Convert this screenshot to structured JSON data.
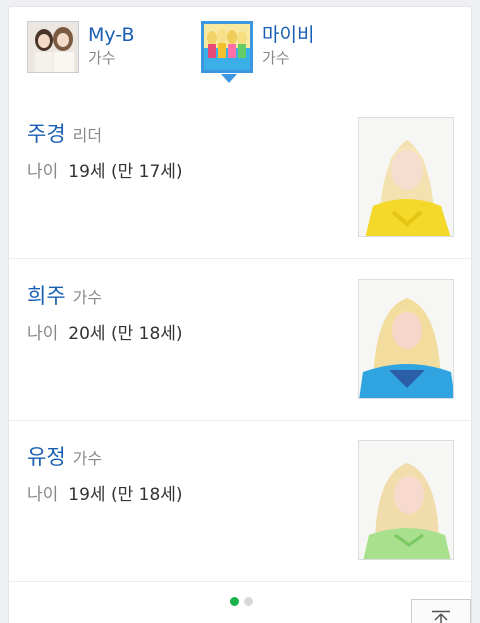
{
  "groups": [
    {
      "name": "My-B",
      "sub": "가수",
      "thumb_icon": "group-photo-icon",
      "active": false
    },
    {
      "name": "마이비",
      "sub": "가수",
      "thumb_icon": "group-photo-icon",
      "active": true
    }
  ],
  "members": [
    {
      "name": "주경",
      "role": "리더",
      "age_label": "나이",
      "age": "19세 (만 17세)",
      "photo_icon": "member-photo-icon"
    },
    {
      "name": "희주",
      "role": "가수",
      "age_label": "나이",
      "age": "20세 (만 18세)",
      "photo_icon": "member-photo-icon"
    },
    {
      "name": "유정",
      "role": "가수",
      "age_label": "나이",
      "age": "19세 (만 18세)",
      "photo_icon": "member-photo-icon"
    }
  ],
  "pager": {
    "total": 2,
    "current": 1
  },
  "colors": {
    "accent": "#1a5fb4",
    "active_border": "#3d96e0",
    "pager_active": "#19b34a"
  }
}
